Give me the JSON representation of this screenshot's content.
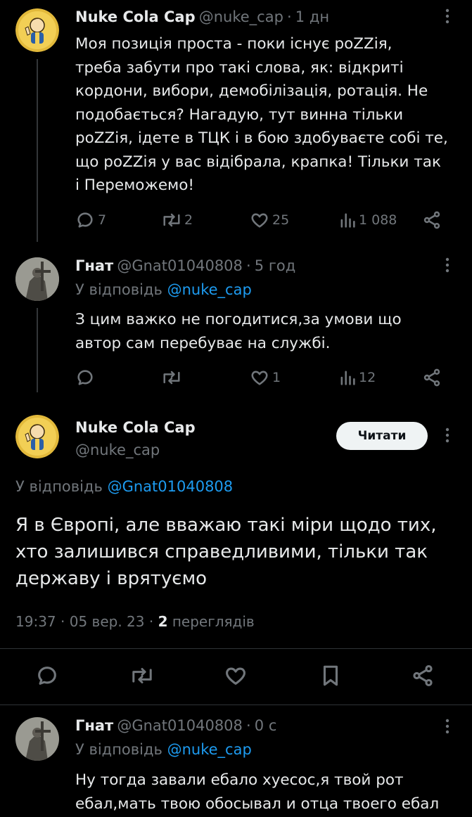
{
  "tweet1": {
    "name": "Nuke Cola Cap",
    "handle": "@nuke_cap",
    "sep": "·",
    "time": "1 дн",
    "text": "Моя позиція проста - поки існує poZZія,\nтреба забути про такі слова, як: відкриті\nкордони, вибори, демобілізація, ротація. Не\nподобається? Нагадую, тут винна тільки\npoZZія, ідете в ТЦК і в бою здобуваєте собі те,\nщо poZZія у вас відібрала, крапка! Тільки так\nі Переможемо!",
    "replies": "7",
    "retweets": "2",
    "likes": "25",
    "views": "1 088"
  },
  "tweet2": {
    "name": "Гнат",
    "handle": "@Gnat01040808",
    "sep": "·",
    "time": "5 год",
    "reply_prefix": "У відповідь",
    "reply_to": "@nuke_cap",
    "text": "З цим важко не погодитися,за умови що\nавтор сам перебуває на службі.",
    "replies": "",
    "retweets": "",
    "likes": "1",
    "views": "12"
  },
  "main_tweet": {
    "name": "Nuke Cola Cap",
    "handle": "@nuke_cap",
    "follow_label": "Читати",
    "reply_prefix": "У відповідь",
    "reply_to": "@Gnat01040808",
    "text": "Я в Європі, але вважаю такі міри щодо тих,\nхто залишився справедливими, тільки так\nдержаву і врятуємо",
    "time": "19:37",
    "sep1": "·",
    "date": "05 вер. 23",
    "sep2": "·",
    "views_count": "2",
    "views_label": "переглядів"
  },
  "tweet4": {
    "name": "Гнат",
    "handle": "@Gnat01040808",
    "sep": "·",
    "time": "0 с",
    "reply_prefix": "У відповідь",
    "reply_to": "@nuke_cap",
    "text": "Ну тогда завали ебало хуесос,я твой рот\nебал,мать твою обосывал и отца твоего ебал"
  },
  "colors": {
    "background": "#000000",
    "text": "#e7e9ea",
    "muted": "#71767b",
    "link": "#1d9bf0",
    "button_bg": "#eff3f4"
  },
  "icons": [
    "vault-boy-avatar",
    "soldier-statue-avatar",
    "reply-icon",
    "retweet-icon",
    "like-icon",
    "views-icon",
    "share-icon",
    "bookmark-icon",
    "more-icon"
  ]
}
